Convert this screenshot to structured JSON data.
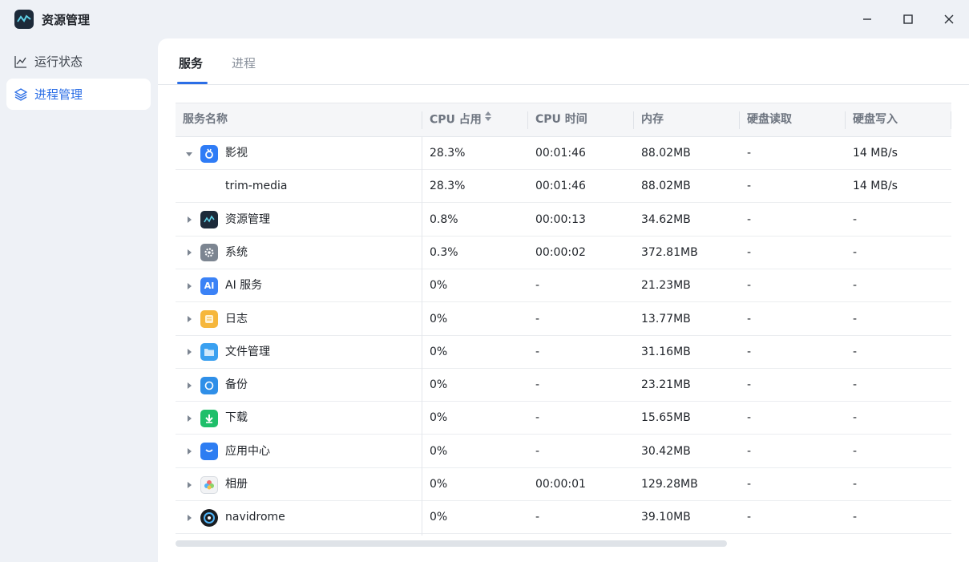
{
  "window": {
    "title": "资源管理",
    "minimize_icon": "minimize-icon",
    "maximize_icon": "maximize-icon",
    "close_icon": "close-icon"
  },
  "sidebar": {
    "items": [
      {
        "label": "运行状态",
        "icon": "line-chart-icon",
        "active": false
      },
      {
        "label": "进程管理",
        "icon": "layers-icon",
        "active": true
      }
    ]
  },
  "tabs": [
    {
      "label": "服务",
      "active": true
    },
    {
      "label": "进程",
      "active": false
    }
  ],
  "table": {
    "columns": [
      "服务名称",
      "CPU 占用",
      "CPU 时间",
      "内存",
      "硬盘读取",
      "硬盘写入"
    ],
    "sort_column": "CPU 占用",
    "rows": [
      {
        "name": "影视",
        "cpu": "28.3%",
        "cpu_time": "00:01:46",
        "memory": "88.02MB",
        "disk_read": "-",
        "disk_write": "14 MB/s",
        "expanded": true,
        "icon": "video-app-icon",
        "icon_color": "#2f7cf6"
      },
      {
        "name": "trim-media",
        "cpu": "28.3%",
        "cpu_time": "00:01:46",
        "memory": "88.02MB",
        "disk_read": "-",
        "disk_write": "14 MB/s",
        "child": true
      },
      {
        "name": "资源管理",
        "cpu": "0.8%",
        "cpu_time": "00:00:13",
        "memory": "34.62MB",
        "disk_read": "-",
        "disk_write": "-",
        "icon": "resource-monitor-icon",
        "icon_color": "#1c2a3a"
      },
      {
        "name": "系统",
        "cpu": "0.3%",
        "cpu_time": "00:00:02",
        "memory": "372.81MB",
        "disk_read": "-",
        "disk_write": "-",
        "icon": "gear-icon",
        "icon_color": "#7c8591"
      },
      {
        "name": "AI 服务",
        "cpu": "0%",
        "cpu_time": "-",
        "memory": "21.23MB",
        "disk_read": "-",
        "disk_write": "-",
        "icon": "ai-icon",
        "icon_color": "#3b82f6",
        "icon_text": "AI"
      },
      {
        "name": "日志",
        "cpu": "0%",
        "cpu_time": "-",
        "memory": "13.77MB",
        "disk_read": "-",
        "disk_write": "-",
        "icon": "log-icon",
        "icon_color": "#f6b73c"
      },
      {
        "name": "文件管理",
        "cpu": "0%",
        "cpu_time": "-",
        "memory": "31.16MB",
        "disk_read": "-",
        "disk_write": "-",
        "icon": "folder-icon",
        "icon_color": "#3aa0f0"
      },
      {
        "name": "备份",
        "cpu": "0%",
        "cpu_time": "-",
        "memory": "23.21MB",
        "disk_read": "-",
        "disk_write": "-",
        "icon": "backup-icon",
        "icon_color": "#2f8fe8"
      },
      {
        "name": "下载",
        "cpu": "0%",
        "cpu_time": "-",
        "memory": "15.65MB",
        "disk_read": "-",
        "disk_write": "-",
        "icon": "download-icon",
        "icon_color": "#1fbf6a"
      },
      {
        "name": "应用中心",
        "cpu": "0%",
        "cpu_time": "-",
        "memory": "30.42MB",
        "disk_read": "-",
        "disk_write": "-",
        "icon": "app-store-icon",
        "icon_color": "#2d7df2"
      },
      {
        "name": "相册",
        "cpu": "0%",
        "cpu_time": "00:00:01",
        "memory": "129.28MB",
        "disk_read": "-",
        "disk_write": "-",
        "icon": "photos-icon",
        "icon_color": "#f2f3f5"
      },
      {
        "name": "navidrome",
        "cpu": "0%",
        "cpu_time": "-",
        "memory": "39.10MB",
        "disk_read": "-",
        "disk_write": "-",
        "icon": "music-disc-icon",
        "icon_color": "#1a1d21"
      }
    ]
  },
  "colors": {
    "accent": "#2b6ee6",
    "background": "#eef1f6",
    "panel": "#ffffff"
  }
}
